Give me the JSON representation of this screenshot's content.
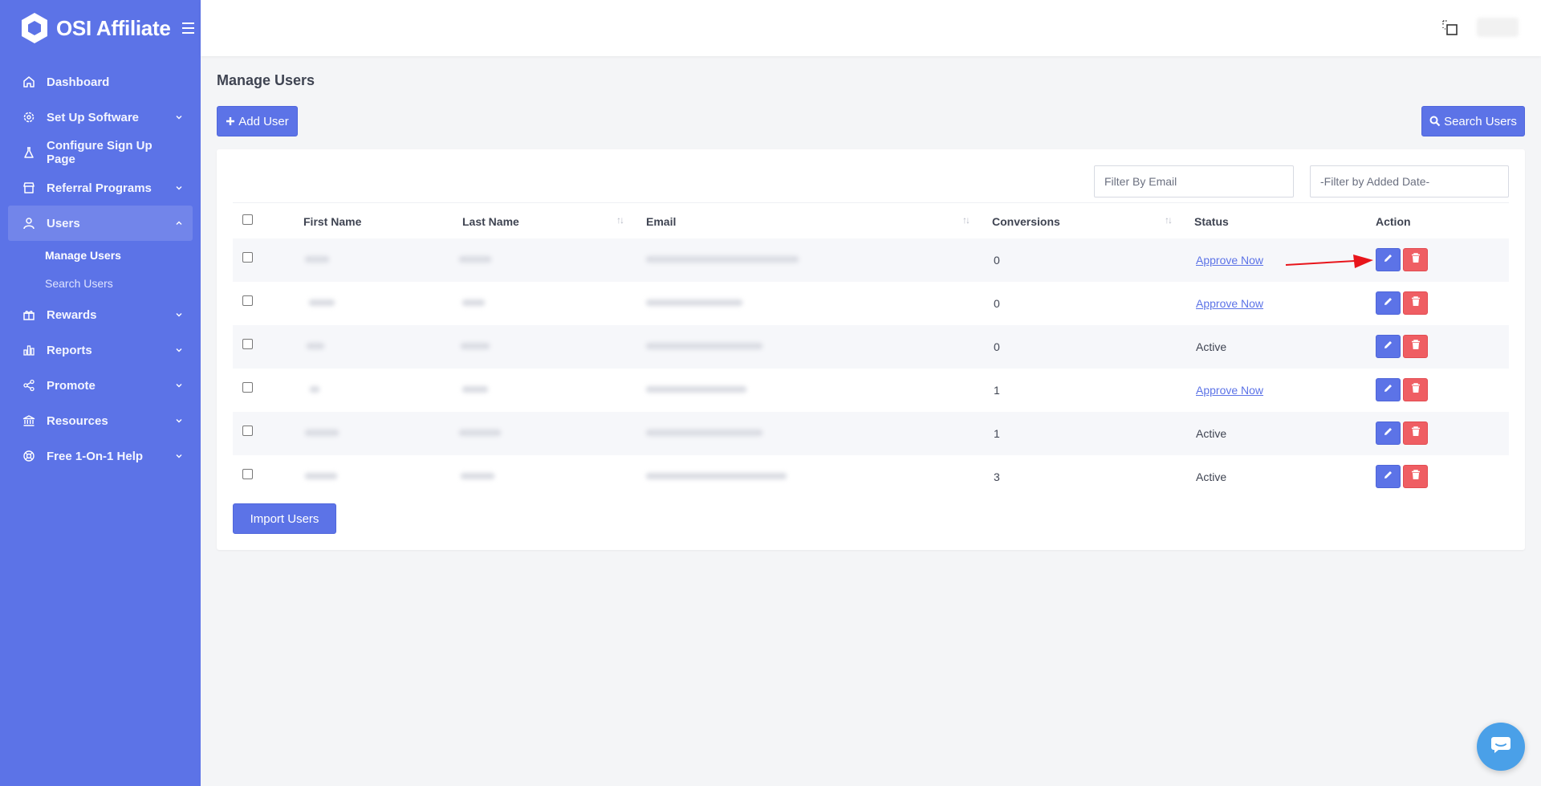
{
  "brand": {
    "name": "OSI Affiliate"
  },
  "sidebar": {
    "items": [
      {
        "label": "Dashboard",
        "icon": "home-icon",
        "expandable": false
      },
      {
        "label": "Set Up Software",
        "icon": "gear-icon",
        "expandable": true
      },
      {
        "label": "Configure Sign Up Page",
        "icon": "flask-icon",
        "expandable": false
      },
      {
        "label": "Referral Programs",
        "icon": "store-icon",
        "expandable": true
      },
      {
        "label": "Users",
        "icon": "user-icon",
        "expandable": true,
        "active": true,
        "subitems": [
          {
            "label": "Manage Users"
          },
          {
            "label": "Search Users"
          }
        ]
      },
      {
        "label": "Rewards",
        "icon": "gift-icon",
        "expandable": true
      },
      {
        "label": "Reports",
        "icon": "chart-icon",
        "expandable": true
      },
      {
        "label": "Promote",
        "icon": "share-icon",
        "expandable": true
      },
      {
        "label": "Resources",
        "icon": "bank-icon",
        "expandable": true
      },
      {
        "label": "Free 1-On-1 Help",
        "icon": "lifebuoy-icon",
        "expandable": true
      }
    ]
  },
  "page": {
    "title": "Manage Users",
    "add_user_label": "Add User",
    "search_users_label": "Search Users",
    "import_users_label": "Import Users"
  },
  "filters": {
    "email_placeholder": "Filter By Email",
    "date_placeholder": "-Filter by Added Date-"
  },
  "table": {
    "columns": [
      "First Name",
      "Last Name",
      "Email",
      "Conversions",
      "Status",
      "Action"
    ],
    "rows": [
      {
        "conversions": "0",
        "status": "Approve Now",
        "status_is_link": true
      },
      {
        "conversions": "0",
        "status": "Approve Now",
        "status_is_link": true
      },
      {
        "conversions": "0",
        "status": "Active",
        "status_is_link": false
      },
      {
        "conversions": "1",
        "status": "Approve Now",
        "status_is_link": true
      },
      {
        "conversions": "1",
        "status": "Active",
        "status_is_link": false
      },
      {
        "conversions": "3",
        "status": "Active",
        "status_is_link": false
      }
    ]
  },
  "colors": {
    "sidebar": "#5c73e7",
    "primary": "#5c73e7",
    "danger": "#ef5e63",
    "annotation_arrow": "#e8151b"
  }
}
